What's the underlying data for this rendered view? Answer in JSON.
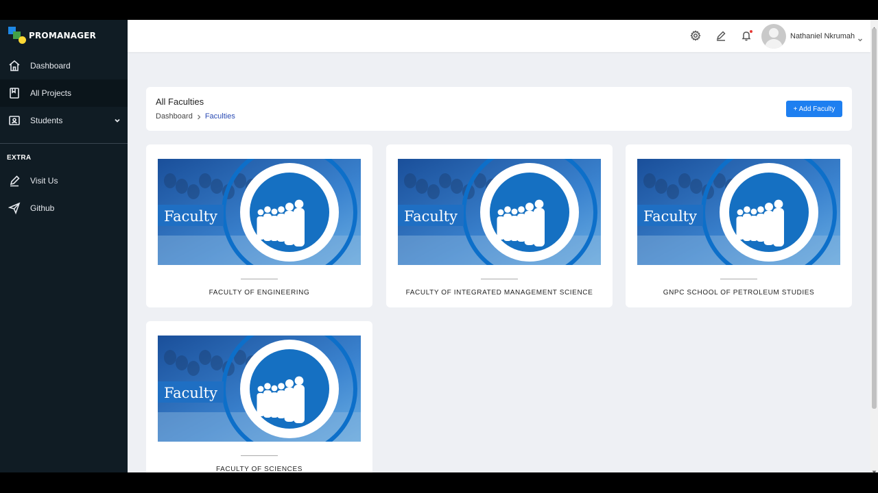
{
  "app": {
    "logo_text": "PROMANAGER"
  },
  "sidebar": {
    "items": [
      {
        "label": "Dashboard",
        "icon": "home-icon"
      },
      {
        "label": "All Projects",
        "icon": "book-icon"
      },
      {
        "label": "Students",
        "icon": "id-card-icon"
      }
    ],
    "extra_label": "EXTRA",
    "extra_items": [
      {
        "label": "Visit Us",
        "icon": "pencil-icon"
      },
      {
        "label": "Github",
        "icon": "send-icon"
      }
    ]
  },
  "topbar": {
    "user_name": "Nathaniel Nkrumah",
    "icons": [
      "gear-icon",
      "pencil-icon",
      "bell-icon"
    ]
  },
  "header": {
    "title": "All Faculties",
    "breadcrumb": [
      "Dashboard",
      "Faculties"
    ],
    "add_button": "+ Add Faculty"
  },
  "faculties": [
    {
      "name": "FACULTY OF ENGINEERING",
      "image_text": "Faculty"
    },
    {
      "name": "FACULTY OF INTEGRATED MANAGEMENT SCIENCE",
      "image_text": "Faculty"
    },
    {
      "name": "GNPC SCHOOL OF PETROLEUM STUDIES",
      "image_text": "Faculty"
    },
    {
      "name": "FACULTY OF SCIENCES",
      "image_text": "Faculty"
    }
  ],
  "colors": {
    "sidebar_bg": "#101c24",
    "accent": "#1e7ff0",
    "breadcrumb_active": "#2a4bb4",
    "page_bg": "#eef0f4"
  }
}
